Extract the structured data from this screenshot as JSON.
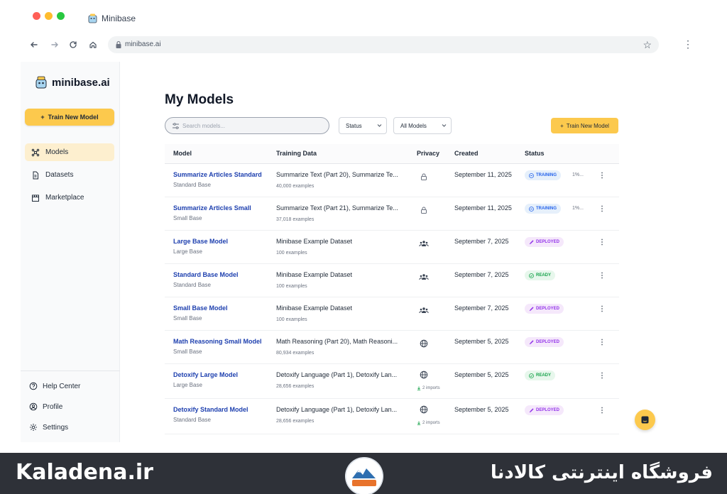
{
  "browser": {
    "tab_title": "Minibase",
    "url": "minibase.ai"
  },
  "sidebar": {
    "brand": "minibase.ai",
    "train_button": "Train New Model",
    "nav": [
      {
        "label": "Models"
      },
      {
        "label": "Datasets"
      },
      {
        "label": "Marketplace"
      }
    ],
    "footer": [
      {
        "label": "Help Center"
      },
      {
        "label": "Profile"
      },
      {
        "label": "Settings"
      }
    ]
  },
  "main": {
    "title": "My Models",
    "search_placeholder": "Search models...",
    "status_filter": "Status",
    "models_filter": "All Models",
    "train_button": "Train New Model",
    "columns": [
      "Model",
      "Training Data",
      "Privacy",
      "Created",
      "Status"
    ],
    "rows": [
      {
        "name": "Summarize Articles Standard",
        "base": "Standard Base",
        "data": "Summarize Text (Part 20), Summarize Te...",
        "count": "40,000 examples",
        "privacy": "lock-icon",
        "imports": "",
        "created": "September 11, 2025",
        "status": "TRAINING",
        "progress": "1%..."
      },
      {
        "name": "Summarize Articles Small",
        "base": "Small Base",
        "data": "Summarize Text (Part 21), Summarize Te...",
        "count": "37,018 examples",
        "privacy": "lock-icon",
        "imports": "",
        "created": "September 11, 2025",
        "status": "TRAINING",
        "progress": "1%..."
      },
      {
        "name": "Large Base Model",
        "base": "Large Base",
        "data": "Minibase Example Dataset",
        "count": "100 examples",
        "privacy": "team-icon",
        "imports": "",
        "created": "September 7, 2025",
        "status": "DEPLOYED",
        "progress": ""
      },
      {
        "name": "Standard Base Model",
        "base": "Standard Base",
        "data": "Minibase Example Dataset",
        "count": "100 examples",
        "privacy": "team-icon",
        "imports": "",
        "created": "September 7, 2025",
        "status": "READY",
        "progress": ""
      },
      {
        "name": "Small Base Model",
        "base": "Small Base",
        "data": "Minibase Example Dataset",
        "count": "100 examples",
        "privacy": "team-icon",
        "imports": "",
        "created": "September 7, 2025",
        "status": "DEPLOYED",
        "progress": ""
      },
      {
        "name": "Math Reasoning Small Model",
        "base": "Small Base",
        "data": "Math Reasoning (Part 20), Math Reasoni...",
        "count": "80,934 examples",
        "privacy": "globe-icon",
        "imports": "",
        "created": "September 5, 2025",
        "status": "DEPLOYED",
        "progress": ""
      },
      {
        "name": "Detoxify Large Model",
        "base": "Large Base",
        "data": "Detoxify Language (Part 1), Detoxify Lan...",
        "count": "28,656 examples",
        "privacy": "globe-icon",
        "imports": "2 imports",
        "created": "September 5, 2025",
        "status": "READY",
        "progress": ""
      },
      {
        "name": "Detoxify Standard Model",
        "base": "Standard Base",
        "data": "Detoxify Language (Part 1), Detoxify Lan...",
        "count": "28,656 examples",
        "privacy": "globe-icon",
        "imports": "2 imports",
        "created": "September 5, 2025",
        "status": "DEPLOYED",
        "progress": ""
      }
    ]
  },
  "watermark": {
    "left_text": "Kaladena.ir",
    "right_text": "فروشگاه اینترنتی کالادنا",
    "logo_text": "کالادنا"
  },
  "colors": {
    "accent": "#fcc94d",
    "link": "#1e40af",
    "training": "#2563eb",
    "deployed": "#9333ea",
    "ready": "#16a34a"
  }
}
